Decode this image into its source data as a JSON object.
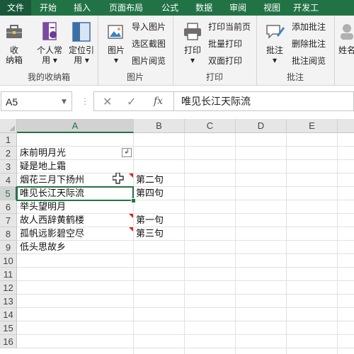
{
  "tabs": [
    {
      "label": "文件",
      "active": true
    },
    {
      "label": "开始",
      "active": false
    },
    {
      "label": "插入",
      "active": false
    },
    {
      "label": "页面布局",
      "active": false
    },
    {
      "label": "公式",
      "active": false
    },
    {
      "label": "数据",
      "active": false
    },
    {
      "label": "审阅",
      "active": false
    },
    {
      "label": "视图",
      "active": false
    },
    {
      "label": "开发工",
      "active": false
    }
  ],
  "ribbon": {
    "collection": {
      "label": "我的收纳箱",
      "receive": "收\n纳箱",
      "personal": "个人常\n用 ▾",
      "locate": "定位引\n用 ▾"
    },
    "picture": {
      "label": "图片",
      "picture_btn": "图片\n▾",
      "import": "导入图片",
      "screenshot": "选区截图",
      "browse": "图片阅览"
    },
    "print": {
      "label": "打印",
      "print_btn": "打印\n▾",
      "print_current": "打印当前页",
      "batch": "批量打印",
      "duplex": "双面打印"
    },
    "comment": {
      "label": "批注",
      "comment_btn": "批注\n▾",
      "add": "添加批注",
      "delete": "删除批注",
      "read": "批注阅览"
    },
    "extra": {
      "partial": "姓名"
    }
  },
  "formula": {
    "namebox": "A5",
    "content": "唯见长江天际流"
  },
  "grid": {
    "columns": [
      "A",
      "B",
      "C",
      "D",
      "E"
    ],
    "rows": [
      "1",
      "2",
      "3",
      "4",
      "5",
      "6",
      "7",
      "8",
      "9",
      "10",
      "11",
      "12",
      "13",
      "14",
      "15",
      "16"
    ],
    "cells_a": [
      "",
      "床前明月光",
      "疑是地上霜",
      "烟花三月下扬州",
      "唯见长江天际流",
      "举头望明月",
      "故人西辞黄鹤楼",
      "孤帆远影碧空尽",
      "低头思故乡"
    ],
    "cells_b": [
      "",
      "",
      "",
      "第二句",
      "第四句",
      "",
      "第一句",
      "第三句",
      ""
    ]
  },
  "colors": {
    "accent": "#217346",
    "comment_marker": "#e02020"
  }
}
